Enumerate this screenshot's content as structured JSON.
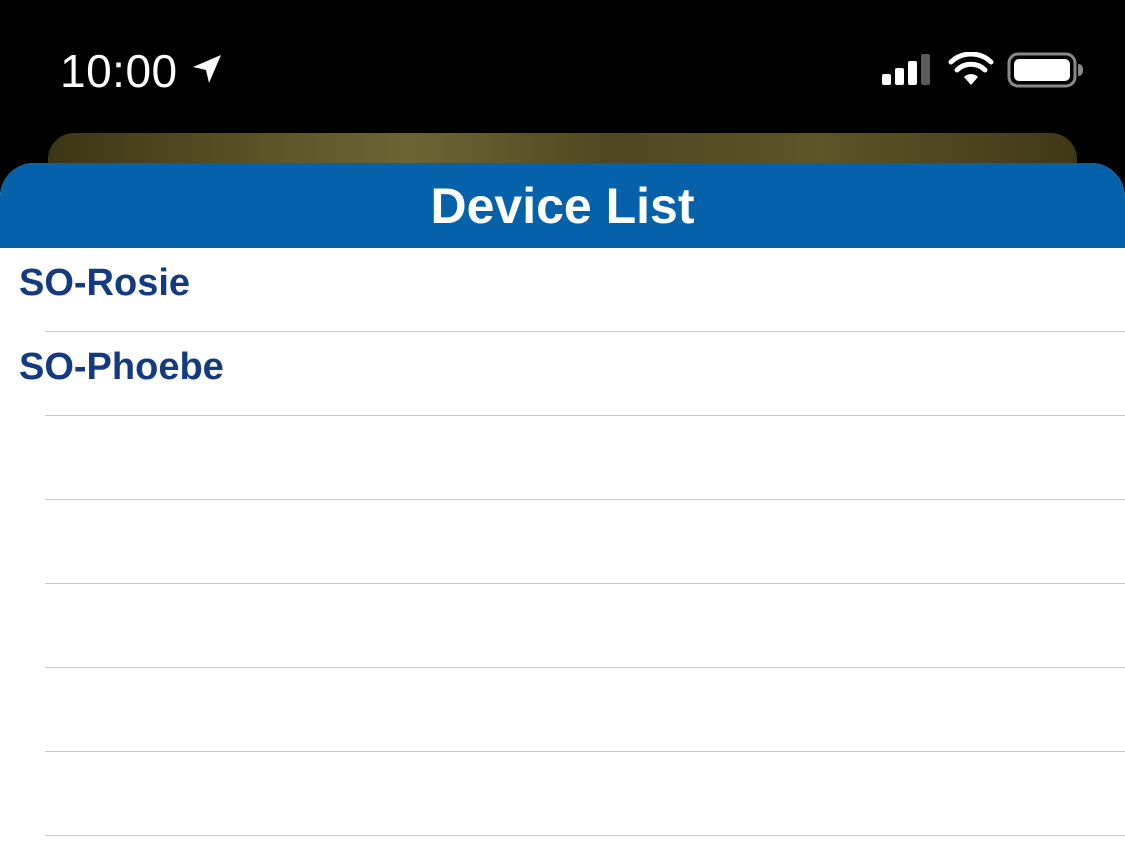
{
  "status_bar": {
    "time": "10:00",
    "icons": [
      "location-arrow-icon",
      "cellular-signal-icon",
      "wifi-icon",
      "battery-icon"
    ]
  },
  "sheet": {
    "title": "Device List",
    "header_color": "#0561aa",
    "text_color": "#143a80"
  },
  "devices": [
    {
      "label": "SO-Rosie"
    },
    {
      "label": "SO-Phoebe"
    },
    {
      "label": ""
    },
    {
      "label": ""
    },
    {
      "label": ""
    },
    {
      "label": ""
    },
    {
      "label": ""
    }
  ]
}
